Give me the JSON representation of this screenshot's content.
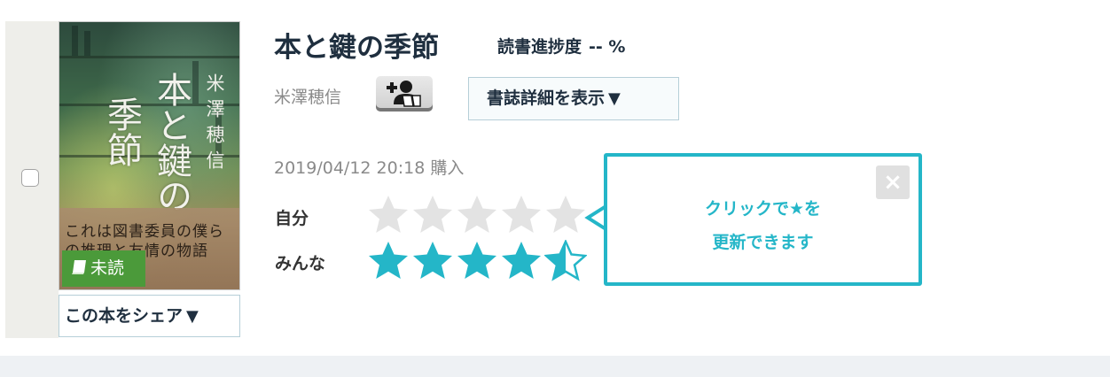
{
  "book": {
    "title": "本と鍵の季節",
    "author": "米澤穂信",
    "progress_label": "読書進捗度",
    "progress_value": "-- %",
    "purchase_date": "2019/04/12 20:18",
    "purchase_suffix": "購入",
    "status_badge": "未読",
    "cover": {
      "title_line1": "本と鍵の",
      "title_line2": "季節",
      "author": "米澤穂信",
      "band_text": "これは図書委員の僕らの推理と友情の物語"
    }
  },
  "buttons": {
    "share_label": "この本をシェア",
    "detail_label": "書誌詳細を表示",
    "dropdown_glyph": "▼"
  },
  "rating": {
    "my_label": "自分",
    "all_label": "みんな",
    "my_stars": 0,
    "all_stars": 4.5,
    "max_stars": 5
  },
  "popup": {
    "line1": "クリックで★を",
    "line2": "更新できます",
    "close_glyph": "×"
  },
  "colors": {
    "accent_teal": "#24b6c8",
    "star_empty": "#e3e3e3",
    "badge_green": "#4b9a3a",
    "title_navy": "#1f2f3f"
  },
  "icons": {
    "follow": "add-user-book-icon",
    "close": "close-icon",
    "unread": "book-icon"
  }
}
